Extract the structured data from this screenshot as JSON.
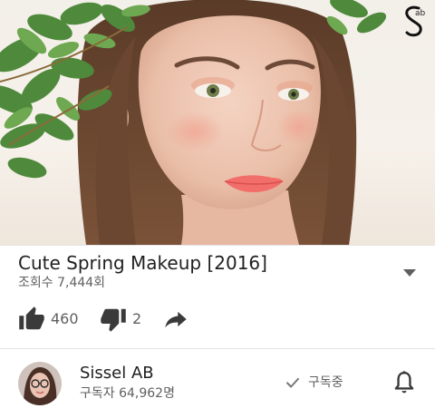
{
  "video": {
    "title": "Cute Spring Makeup [2016]",
    "views": "조회수 7,444회"
  },
  "actions": {
    "like_count": "460",
    "dislike_count": "2"
  },
  "channel": {
    "name": "Sissel AB",
    "subscribers": "구독자 64,962명",
    "subscribed_label": "구독중"
  },
  "icons": {
    "expand": "chevron-down-icon",
    "like": "thumbs-up-icon",
    "dislike": "thumbs-down-icon",
    "share": "share-icon",
    "subscribed": "checkmark-icon",
    "notifications": "bell-icon",
    "watermark": "channel-logo-watermark"
  },
  "colors": {
    "text_primary": "#212121",
    "text_secondary": "#606060",
    "icon_dark": "#333333"
  }
}
